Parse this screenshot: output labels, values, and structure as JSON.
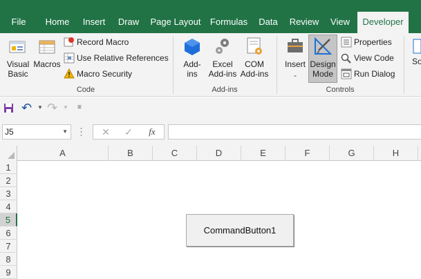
{
  "tabs": [
    "File",
    "Home",
    "Insert",
    "Draw",
    "Page Layout",
    "Formulas",
    "Data",
    "Review",
    "View",
    "Developer"
  ],
  "active_tab": "Developer",
  "ribbon": {
    "code": {
      "label": "Code",
      "visual_basic": [
        "Visual",
        "Basic"
      ],
      "macros": "Macros",
      "record_macro": "Record Macro",
      "use_relative_references": "Use Relative References",
      "macro_security": "Macro Security"
    },
    "addins": {
      "label": "Add-ins",
      "addins": [
        "Add-",
        "ins"
      ],
      "excel_addins": [
        "Excel",
        "Add-ins"
      ],
      "com_addins": [
        "COM",
        "Add-ins"
      ]
    },
    "controls": {
      "label": "Controls",
      "insert": "Insert",
      "design_mode": [
        "Design",
        "Mode"
      ],
      "properties": "Properties",
      "view_code": "View Code",
      "run_dialog": "Run Dialog"
    },
    "partial_next": "So"
  },
  "formula_bar": {
    "name_box": "J5",
    "fx": "fx",
    "formula": ""
  },
  "columns": [
    "A",
    "B",
    "C",
    "D",
    "E",
    "F",
    "G",
    "H"
  ],
  "rows": [
    "1",
    "2",
    "3",
    "4",
    "5",
    "6",
    "7",
    "8",
    "9"
  ],
  "selected_row": "5",
  "command_button": "CommandButton1",
  "colors": {
    "brand": "#217346",
    "ribbon_bg": "#f3f3f3"
  }
}
